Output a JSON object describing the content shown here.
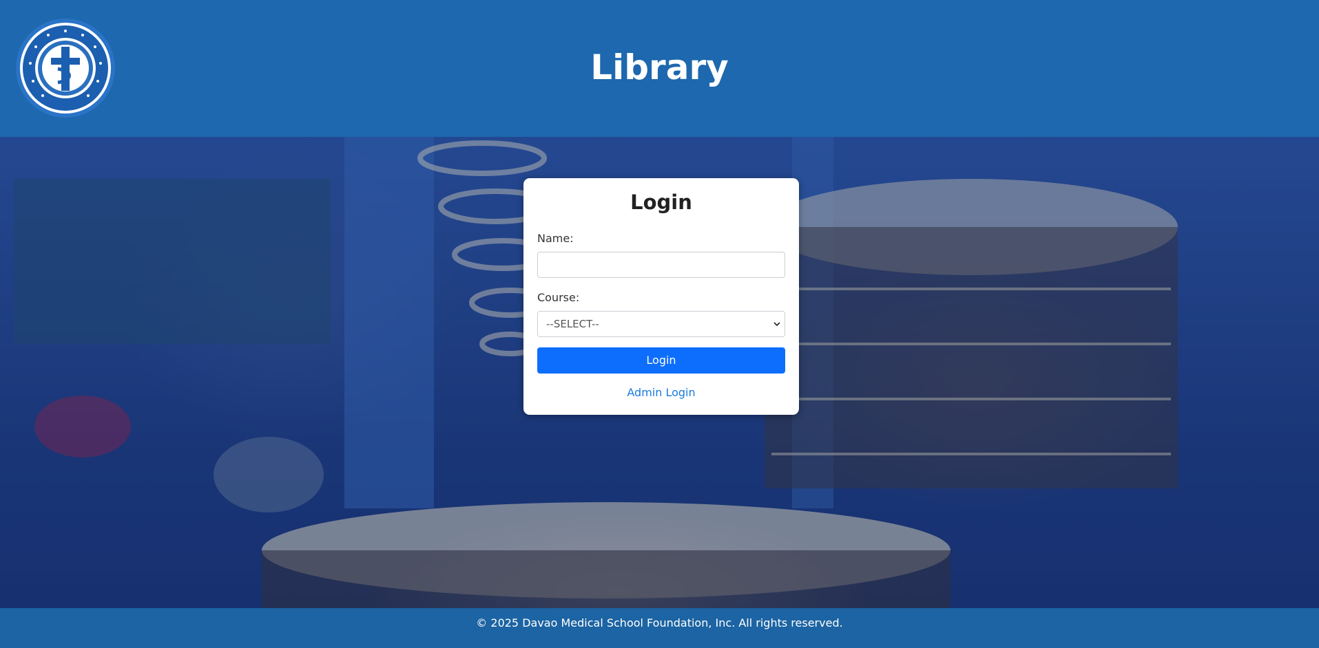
{
  "header": {
    "title": "Library",
    "logo": {
      "text_top": "DAVAO MEDICAL SCHOOL FOUNDATION, INC.",
      "year": "1976",
      "icon": "cross-caduceus-seal"
    }
  },
  "login": {
    "title": "Login",
    "name_label": "Name:",
    "name_value": "",
    "course_label": "Course:",
    "course_selected": "--SELECT--",
    "submit_label": "Login",
    "admin_link": "Admin Login"
  },
  "footer": {
    "text": "© 2025 Davao Medical School Foundation, Inc. All rights reserved."
  },
  "colors": {
    "header_bg": "#1c6cb2",
    "footer_bg": "#1c64a3",
    "primary_button": "#0d6efd",
    "link": "#1a7be0"
  }
}
